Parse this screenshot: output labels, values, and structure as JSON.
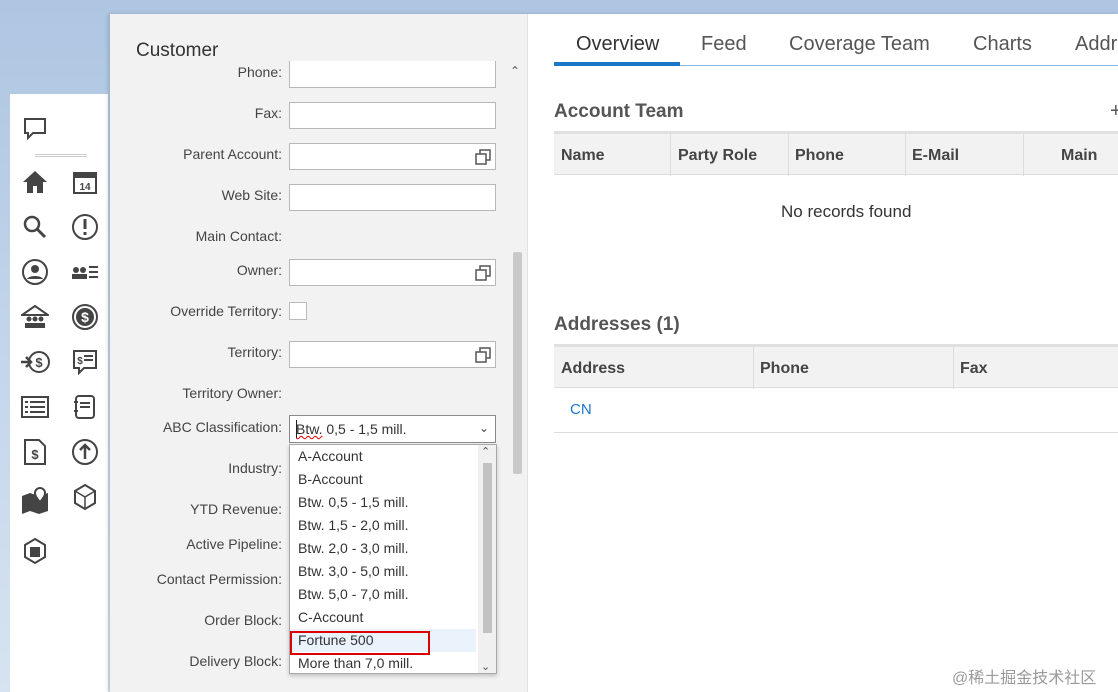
{
  "form": {
    "title": "Customer",
    "labels": {
      "phone": "Phone:",
      "fax": "Fax:",
      "parent_account": "Parent Account:",
      "web_site": "Web Site:",
      "main_contact": "Main Contact:",
      "owner": "Owner:",
      "override_territory": "Override Territory:",
      "territory": "Territory:",
      "territory_owner": "Territory Owner:",
      "abc_classification": "ABC Classification:",
      "industry": "Industry:",
      "ytd_revenue": "YTD Revenue:",
      "active_pipeline": "Active Pipeline:",
      "contact_permission": "Contact Permission:",
      "order_block": "Order Block:",
      "delivery_block": "Delivery Block:"
    },
    "abc_selected": "Btw. 0,5 - 1,5 mill.",
    "abc_selected_prefix": "Btw.",
    "abc_selected_rest": " 0,5 - 1,5 mill.",
    "abc_options": [
      "A-Account",
      "B-Account",
      "Btw. 0,5 - 1,5 mill.",
      "Btw. 1,5 - 2,0 mill.",
      "Btw. 2,0 - 3,0 mill.",
      "Btw. 3,0 - 5,0 mill.",
      "Btw. 5,0 - 7,0 mill.",
      "C-Account",
      "Fortune 500",
      "More than 7,0 mill."
    ],
    "highlighted_option": "Fortune 500"
  },
  "tabs": [
    "Overview",
    "Feed",
    "Coverage Team",
    "Charts",
    "Addr"
  ],
  "active_tab": "Overview",
  "account_team": {
    "title": "Account Team",
    "columns": [
      "Name",
      "Party Role",
      "Phone",
      "E-Mail",
      "Main"
    ],
    "empty_text": "No records found",
    "add_icon": "plus-icon"
  },
  "addresses": {
    "title": "Addresses (1)",
    "columns": [
      "Address",
      "Phone",
      "Fax"
    ],
    "rows": [
      {
        "address": "CN",
        "phone": "",
        "fax": ""
      }
    ]
  },
  "rail_icons": [
    "chat-icon",
    "home-icon",
    "calendar-icon",
    "search-icon",
    "alert-icon",
    "user-icon",
    "contact-list-icon",
    "accounts-icon",
    "dollar-icon",
    "payment-icon",
    "invoice-icon",
    "list-icon",
    "notebook-icon",
    "document-dollar-icon",
    "upload-icon",
    "map-pin-icon",
    "box-icon",
    "package-icon"
  ],
  "watermark": "@稀土掘金技术社区",
  "colors": {
    "accent": "#1d77c9",
    "highlight_box": "#dd0000"
  }
}
